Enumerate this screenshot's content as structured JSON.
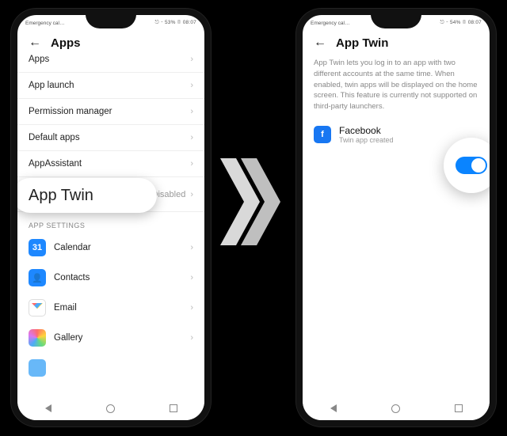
{
  "status": {
    "left": "Emergency cal…",
    "right_left": "⎋ ⌁ 53% ▯ 08:07",
    "right_right": "⎋ ⌁ 54% ▯ 08:07"
  },
  "left_screen": {
    "title": "Apps",
    "rows": [
      {
        "label": "Apps"
      },
      {
        "label": "App launch"
      },
      {
        "label": "Permission manager"
      },
      {
        "label": "Default apps"
      },
      {
        "label": "AppAssistant"
      }
    ],
    "app_twin": {
      "label": "App Twin",
      "value": "Disabled"
    },
    "section": "APP SETTINGS",
    "apps": [
      {
        "label": "Calendar",
        "glyph": "31",
        "iconClass": "ic-cal"
      },
      {
        "label": "Contacts",
        "glyph": "👤",
        "iconClass": "ic-con"
      },
      {
        "label": "Email",
        "glyph": "",
        "iconClass": "ic-mail"
      },
      {
        "label": "Gallery",
        "glyph": "",
        "iconClass": "ic-gal"
      }
    ]
  },
  "right_screen": {
    "title": "App Twin",
    "description": "App Twin lets you log in to an app with two different accounts at the same time. When enabled, twin apps will be displayed on the home screen. This feature is currently not supported on third-party launchers.",
    "app": {
      "name": "Facebook",
      "subtitle": "Twin app created",
      "glyph": "f"
    },
    "toggle_on": true
  }
}
